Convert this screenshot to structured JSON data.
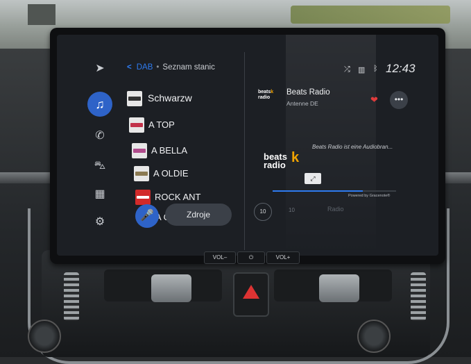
{
  "breadcrumb": {
    "back": "<",
    "source": "DAB",
    "separator": "•",
    "title": "Seznam stanic"
  },
  "status": {
    "time": "12:43"
  },
  "sidebar": {
    "items": [
      {
        "icon": "navigation-icon",
        "glyph": "➤",
        "active": false
      },
      {
        "icon": "music-icon",
        "glyph": "♫",
        "active": true
      },
      {
        "icon": "phone-icon",
        "glyph": "✆",
        "active": false
      },
      {
        "icon": "car-icon",
        "glyph": "⛍",
        "active": false
      },
      {
        "icon": "apps-grid-icon",
        "glyph": "▦",
        "active": false
      },
      {
        "icon": "settings-icon",
        "glyph": "⚙",
        "active": false
      }
    ]
  },
  "stations": [
    {
      "name": "Schwarzw"
    },
    {
      "name": "A TOP"
    },
    {
      "name": "A BELLA"
    },
    {
      "name": "A OLDIE"
    },
    {
      "name": "ROCK ANT"
    },
    {
      "name": "A G"
    }
  ],
  "buttons": {
    "sources": "Zdroje"
  },
  "now_playing": {
    "logo_line1": "beats",
    "logo_line2": "radio",
    "title": "Beats Radio",
    "subtitle": "Antenne DE",
    "description": "Beats Radio ist eine Audiobran...",
    "art_line1": "beats",
    "art_line2": "radio",
    "powered_by": "Powered by Gracenote®",
    "progress": 0.73,
    "rewind": "10",
    "forward": "10",
    "mode": "Radio"
  },
  "hardware": {
    "vol_down": "VOL–",
    "power": "⏻",
    "vol_up": "VOL+"
  },
  "colors": {
    "accent": "#2e63c8",
    "heart": "#e03c3c",
    "beats_k": "#f2a400"
  }
}
